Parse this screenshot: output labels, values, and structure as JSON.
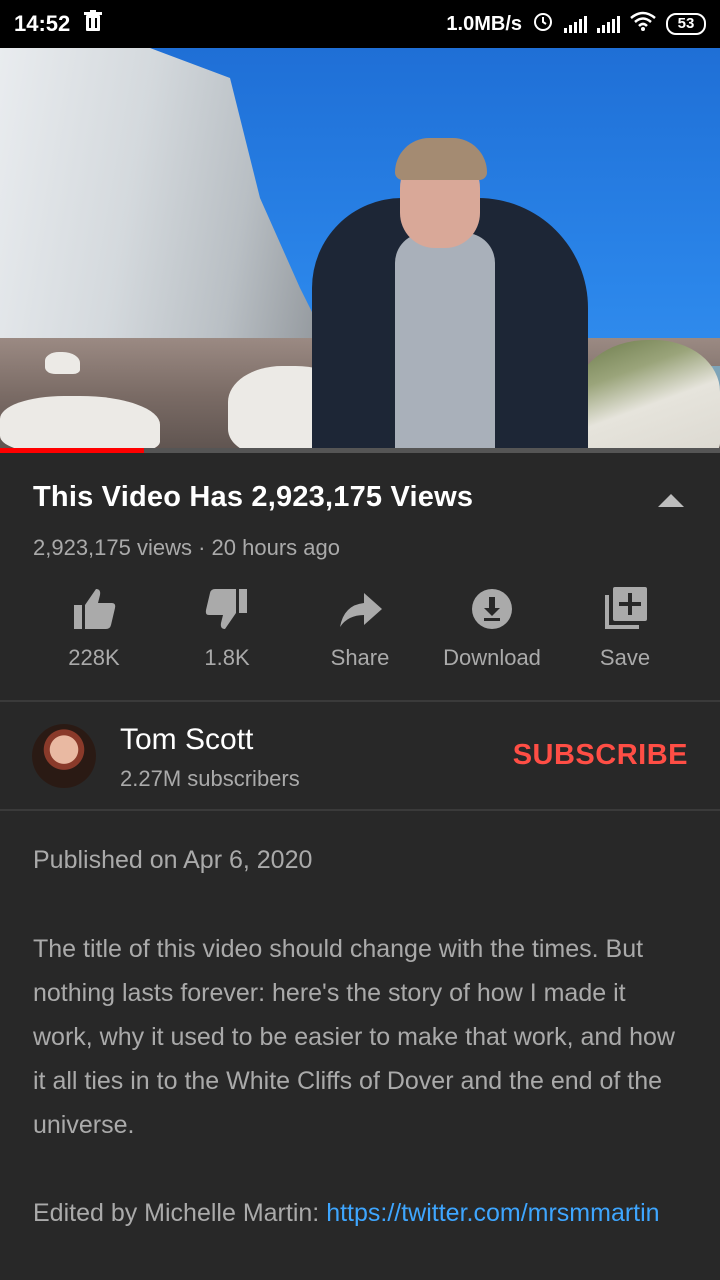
{
  "status_bar": {
    "time": "14:52",
    "network_speed": "1.0MB/s",
    "battery": "53",
    "icons": [
      "trash-icon",
      "alarm-icon",
      "signal-icon",
      "signal-icon",
      "wifi-icon",
      "battery-icon"
    ]
  },
  "video": {
    "progress_fraction": 0.2,
    "progress_color": "#ff0000"
  },
  "info": {
    "title": "This Video Has 2,923,175 Views",
    "meta": "2,923,175 views · 20 hours ago"
  },
  "actions": [
    {
      "label": "228K",
      "icon": "thumbs-up-icon"
    },
    {
      "label": "1.8K",
      "icon": "thumbs-down-icon"
    },
    {
      "label": "Share",
      "icon": "share-icon"
    },
    {
      "label": "Download",
      "icon": "download-icon"
    },
    {
      "label": "Save",
      "icon": "add-to-playlist-icon"
    }
  ],
  "channel": {
    "name": "Tom Scott",
    "subscribers": "2.27M subscribers",
    "subscribe_label": "SUBSCRIBE",
    "subscribe_color": "#ff4e45"
  },
  "description": {
    "published": "Published on Apr 6, 2020",
    "body": "The title of this video should change with the times. But nothing lasts forever: here's the story of how I made it work, why it used to be easier to make that work, and how it all ties in to the White Cliffs of Dover and the end of the universe.",
    "edited_prefix": "Edited by Michelle Martin: ",
    "edited_link": "https://twitter.com/mrsmmartin",
    "link_color": "#3ea6ff"
  }
}
